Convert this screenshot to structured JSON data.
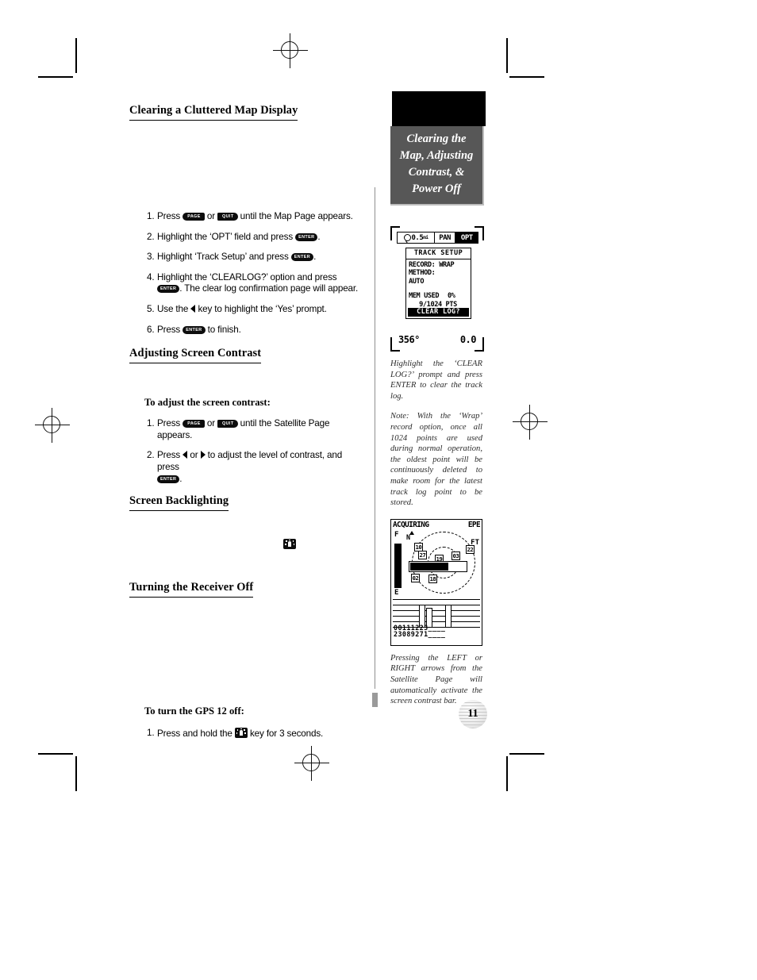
{
  "page": {
    "number": "11",
    "sidebar_title_lines": [
      "Clearing the",
      "Map, Adjusting",
      "Contrast, &",
      "Power Off"
    ]
  },
  "sections": [
    {
      "heading": "Clearing a Cluttered Map Display",
      "steps": [
        {
          "num": "1.",
          "parts": [
            "Press ",
            {
              "key": "PAGE"
            },
            " or ",
            {
              "key": "QUIT"
            },
            " until the Map Page appears."
          ]
        },
        {
          "num": "2.",
          "parts": [
            "Highlight the ‘OPT’ field and press ",
            {
              "key": "ENTER"
            },
            "."
          ]
        },
        {
          "num": "3.",
          "parts": [
            "Highlight ‘Track Setup’ and press ",
            {
              "key": "ENTER"
            },
            "."
          ]
        },
        {
          "num": "4.",
          "parts": [
            "Highlight the ‘CLEARLOG?’ option and press ",
            {
              "key": "ENTER"
            },
            ". The clear log confirmation page will appear."
          ]
        },
        {
          "num": "5.",
          "parts": [
            "Use the ",
            {
              "key": "LEFT-ARROW"
            },
            " key to highlight the ‘Yes’ prompt."
          ]
        },
        {
          "num": "6.",
          "parts": [
            "Press ",
            {
              "key": "ENTER"
            },
            " to finish."
          ]
        }
      ]
    },
    {
      "heading": "Adjusting Screen Contrast",
      "subhead": "To adjust the screen contrast:",
      "steps": [
        {
          "num": "1.",
          "parts": [
            "Press ",
            {
              "key": "PAGE"
            },
            " or ",
            {
              "key": "QUIT"
            },
            " until the Satellite Page appears."
          ]
        },
        {
          "num": "2.",
          "parts": [
            "Press ",
            {
              "key": "LEFT-ARROW"
            },
            " or ",
            {
              "key": "RIGHT-ARROW"
            },
            " to adjust the level of contrast, and press ",
            {
              "key": "ENTER"
            },
            "."
          ]
        }
      ]
    },
    {
      "heading": "Screen Backlighting"
    },
    {
      "heading": "Turning the Receiver Off",
      "subhead": "To turn the GPS 12 off:",
      "steps": [
        {
          "num": "1.",
          "parts": [
            "Press and hold the ",
            {
              "key": "BACKLIGHT"
            },
            " key for 3 seconds."
          ]
        }
      ]
    }
  ],
  "keys": {
    "page_label": "PAGE",
    "quit_label": "QUIT",
    "enter_label": "ENTER"
  },
  "text": {
    "s1_step1_a": "Press",
    "s1_step1_b": "or",
    "s1_step1_c": "until the Map Page appears.",
    "s1_step2_a": "Highlight the ‘OPT’ field and press",
    "s1_step2_b": ".",
    "s1_step3_a": "Highlight ‘Track Setup’ and press",
    "s1_step3_b": ".",
    "s1_step4_a": "Highlight the ‘CLEARLOG?’ option and press",
    "s1_step4_b": ". The clear log confirmation page will appear.",
    "s1_step5_a": "Use the",
    "s1_step5_b": "key to highlight the ‘Yes’ prompt.",
    "s1_step6_a": "Press",
    "s1_step6_b": "to finish.",
    "s2_step1_a": "Press",
    "s2_step1_b": "or",
    "s2_step1_c": "until the Satellite Page appears.",
    "s2_step2_a": "Press",
    "s2_step2_b": "or",
    "s2_step2_c": "to adjust the level of contrast, and press",
    "s2_step2_d": ".",
    "s4_step1_a": "Press and hold the",
    "s4_step1_b": "key for 3 seconds."
  },
  "headings": {
    "clearing_map": "Clearing a Cluttered Map Display",
    "adjusting_contrast": "Adjusting Screen Contrast",
    "screen_backlighting": "Screen Backlighting",
    "receiver_off": "Turning the Receiver Off"
  },
  "subheads": {
    "adjust_contrast": "To adjust the screen contrast:",
    "gps12_off": "To turn the GPS 12 off:"
  },
  "captions": {
    "clear_log": "Highlight the ‘CLEAR LOG?’ prompt and press ENTER to clear the track log.",
    "wrap_note": "Note: With the ‘Wrap’ record option, once all 1024 points are used during normal operation, the oldest point will be continuously deleted to make room for the latest track log point to be stored.",
    "contrast_bar": "Pressing the LEFT or RIGHT arrows from the Satellite Page will automatically activate the screen contrast bar."
  },
  "lcd_track_setup": {
    "topbar": {
      "zoom_icon": "zoom-scale-icon",
      "scale": "0.5",
      "scale_unit": "mi",
      "pan_label": "PAN",
      "opt_label": "OPT",
      "opt_selected": true
    },
    "dialog_title": "TRACK SETUP",
    "record_label": "RECORD:",
    "record_value": "WRAP",
    "method_label": "METHOD:",
    "method_value": "AUTO",
    "mem_label": "MEM USED",
    "mem_percent": "0%",
    "points": "9/1024 PTS",
    "clear_log_prompt": "CLEAR LOG?",
    "footer_heading": "356°",
    "footer_speed": "0.0"
  },
  "lcd_satellite": {
    "status": "ACQUIRING",
    "epe_label": "EPE",
    "fix_mark": "F",
    "east_mark": "E",
    "unit_mark": "FT",
    "north_mark": "N",
    "sky_satellites": [
      "10",
      "27",
      "19",
      "03",
      "22",
      "02",
      "18"
    ],
    "bar_satellites": [
      "02",
      "03",
      "10",
      "18",
      "19",
      "22",
      "27",
      "31"
    ],
    "empty_slots": [
      "--",
      "--",
      "--",
      "--"
    ],
    "contrast_bar_fill_percent": 65
  },
  "colors": {
    "sidebar_gray": "#575757",
    "sidebar_shadow": "#bdbdbd",
    "rule": "#8f8f8f",
    "ink": "#000000"
  }
}
